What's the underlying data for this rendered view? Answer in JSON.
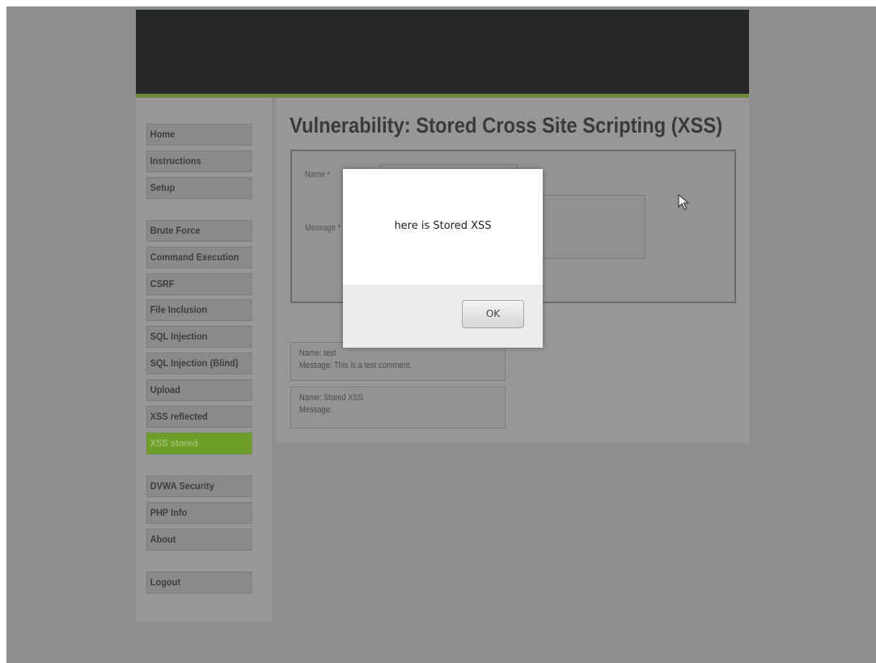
{
  "page": {
    "title": "Vulnerability: Stored Cross Site Scripting (XSS)"
  },
  "sidebar": {
    "groups": [
      [
        {
          "label": "Home"
        },
        {
          "label": "Instructions"
        },
        {
          "label": "Setup"
        }
      ],
      [
        {
          "label": "Brute Force"
        },
        {
          "label": "Command Execution"
        },
        {
          "label": "CSRF"
        },
        {
          "label": "File Inclusion"
        },
        {
          "label": "SQL Injection"
        },
        {
          "label": "SQL Injection (Blind)"
        },
        {
          "label": "Upload"
        },
        {
          "label": "XSS reflected"
        },
        {
          "label": "XSS stored",
          "active": true
        }
      ],
      [
        {
          "label": "DVWA Security"
        },
        {
          "label": "PHP Info"
        },
        {
          "label": "About"
        }
      ],
      [
        {
          "label": "Logout"
        }
      ]
    ]
  },
  "form": {
    "name_label": "Name *",
    "message_label": "Message *",
    "name_value": "",
    "message_value": ""
  },
  "comments": [
    {
      "name": "Name: test",
      "message": "Message: This is a test comment."
    },
    {
      "name": "Name: Stored XSS",
      "message": "Message:"
    }
  ],
  "dialog": {
    "message": "here is Stored XSS",
    "ok_label": "OK"
  },
  "colors": {
    "active_nav": "#6f9d2a",
    "header": "#262828",
    "accent_line": "#6f8a3a"
  }
}
